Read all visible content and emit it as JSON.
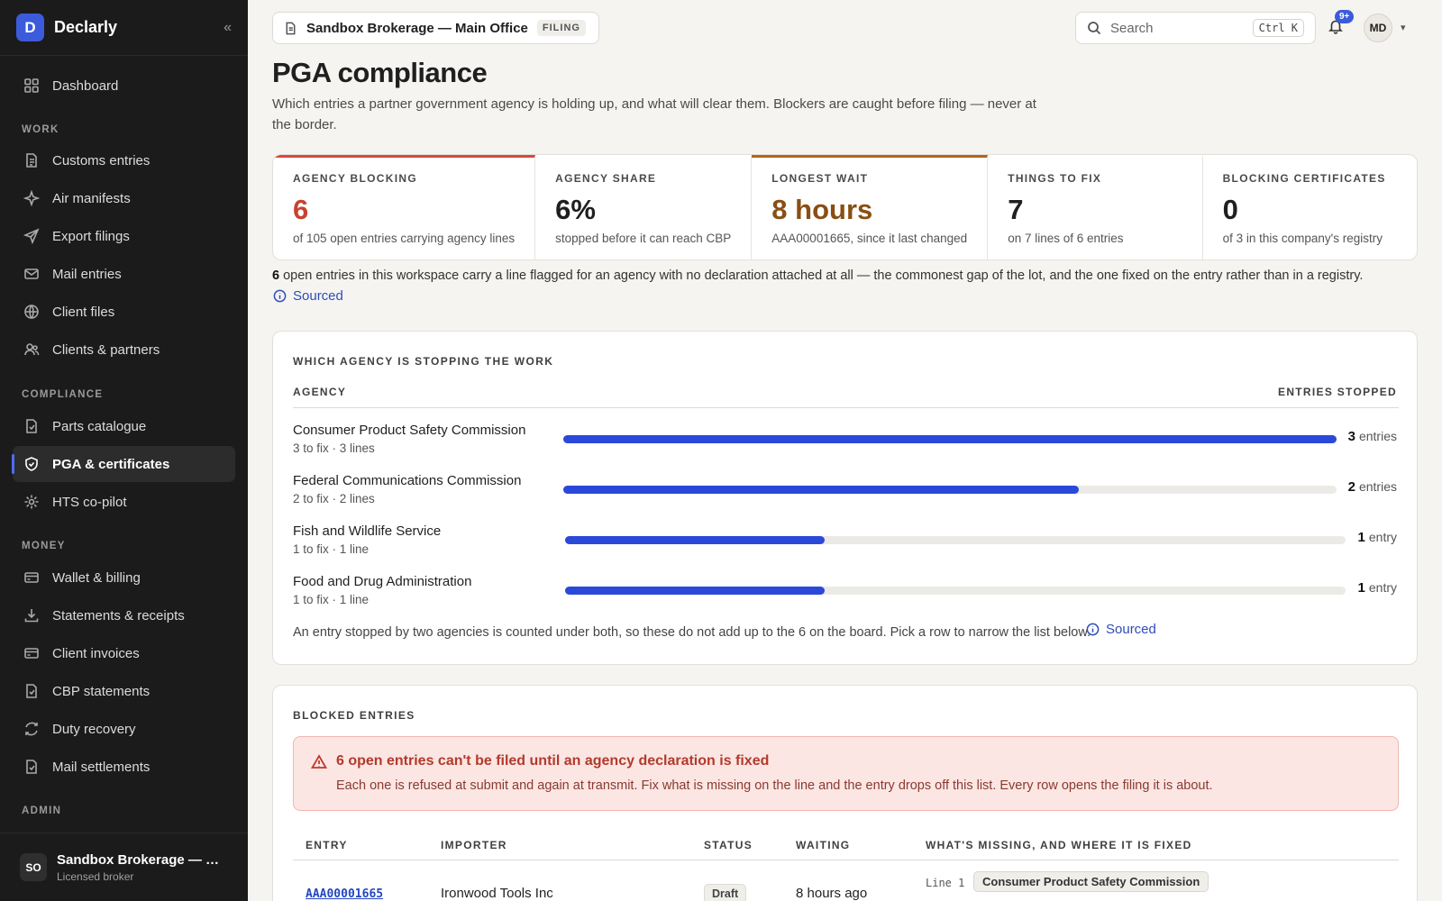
{
  "brand": {
    "logo_letter": "D",
    "name": "Declarly"
  },
  "nav": {
    "dashboard": "Dashboard",
    "work_label": "WORK",
    "customs_entries": "Customs entries",
    "air_manifests": "Air manifests",
    "export_filings": "Export filings",
    "mail_entries": "Mail entries",
    "client_files": "Client files",
    "clients_partners": "Clients & partners",
    "compliance_label": "COMPLIANCE",
    "parts_catalogue": "Parts catalogue",
    "pga_certificates": "PGA & certificates",
    "hts_copilot": "HTS co-pilot",
    "money_label": "MONEY",
    "wallet_billing": "Wallet & billing",
    "statements_receipts": "Statements & receipts",
    "client_invoices": "Client invoices",
    "cbp_statements": "CBP statements",
    "duty_recovery": "Duty recovery",
    "mail_settlements": "Mail settlements",
    "admin_label": "ADMIN"
  },
  "org": {
    "initials": "SO",
    "name": "Sandbox Brokerage — Main Office",
    "role": "Licensed broker"
  },
  "topbar": {
    "office": "Sandbox Brokerage — Main Office",
    "office_tag": "FILING",
    "search_placeholder": "Search",
    "search_shortcut": "Ctrl K",
    "notifications_badge": "9+",
    "user_initials": "MD"
  },
  "page": {
    "title": "PGA compliance",
    "subtitle": "Which entries a partner government agency is holding up, and what will clear them. Blockers are caught before filing — never at the border."
  },
  "stats": [
    {
      "label": "AGENCY BLOCKING",
      "value": "6",
      "note": "of 105 open entries carrying agency lines"
    },
    {
      "label": "AGENCY SHARE",
      "value": "6%",
      "note": "stopped before it can reach CBP"
    },
    {
      "label": "LONGEST WAIT",
      "value": "8 hours",
      "note": "AAA00001665, since it last changed"
    },
    {
      "label": "THINGS TO FIX",
      "value": "7",
      "note": "on 7 lines of 6 entries"
    },
    {
      "label": "BLOCKING CERTIFICATES",
      "value": "0",
      "note": "of 3 in this company's registry"
    }
  ],
  "finding": {
    "count": "6",
    "text": " open entries in this workspace carry a line flagged for an agency with no declaration attached at all — the commonest gap of the lot, and the one fixed on the entry rather than in a registry.",
    "sourced": "Sourced"
  },
  "agency_card": {
    "title": "WHICH AGENCY IS STOPPING THE WORK",
    "col_agency": "AGENCY",
    "col_stopped": "ENTRIES STOPPED",
    "rows": [
      {
        "name": "Consumer Product Safety Commission",
        "sub": "3 to fix · 3 lines",
        "count": "3",
        "unit": "entries",
        "fraction": 1.0
      },
      {
        "name": "Federal Communications Commission",
        "sub": "2 to fix · 2 lines",
        "count": "2",
        "unit": "entries",
        "fraction": 0.667
      },
      {
        "name": "Fish and Wildlife Service",
        "sub": "1 to fix · 1 line",
        "count": "1",
        "unit": "entry",
        "fraction": 0.333
      },
      {
        "name": "Food and Drug Administration",
        "sub": "1 to fix · 1 line",
        "count": "1",
        "unit": "entry",
        "fraction": 0.333
      }
    ],
    "note": "An entry stopped by two agencies is counted under both, so these do not add up to the 6 on the board. Pick a row to narrow the list below.",
    "sourced": "Sourced"
  },
  "blocked": {
    "title": "BLOCKED ENTRIES",
    "alert_title": "6 open entries can't be filed until an agency declaration is fixed",
    "alert_text": "Each one is refused at submit and again at transmit. Fix what is missing on the line and the entry drops off this list. Every row opens the filing it is about.",
    "headers": {
      "entry": "ENTRY",
      "importer": "IMPORTER",
      "status": "STATUS",
      "waiting": "WAITING",
      "missing": "WHAT'S MISSING, AND WHERE IT IS FIXED"
    },
    "rows": [
      {
        "entry": "AAA00001665",
        "importer": "Ironwood Tools Inc",
        "status": "Draft",
        "waiting": "8 hours ago",
        "line": "Line 1",
        "agency": "Consumer Product Safety Commission"
      }
    ]
  }
}
